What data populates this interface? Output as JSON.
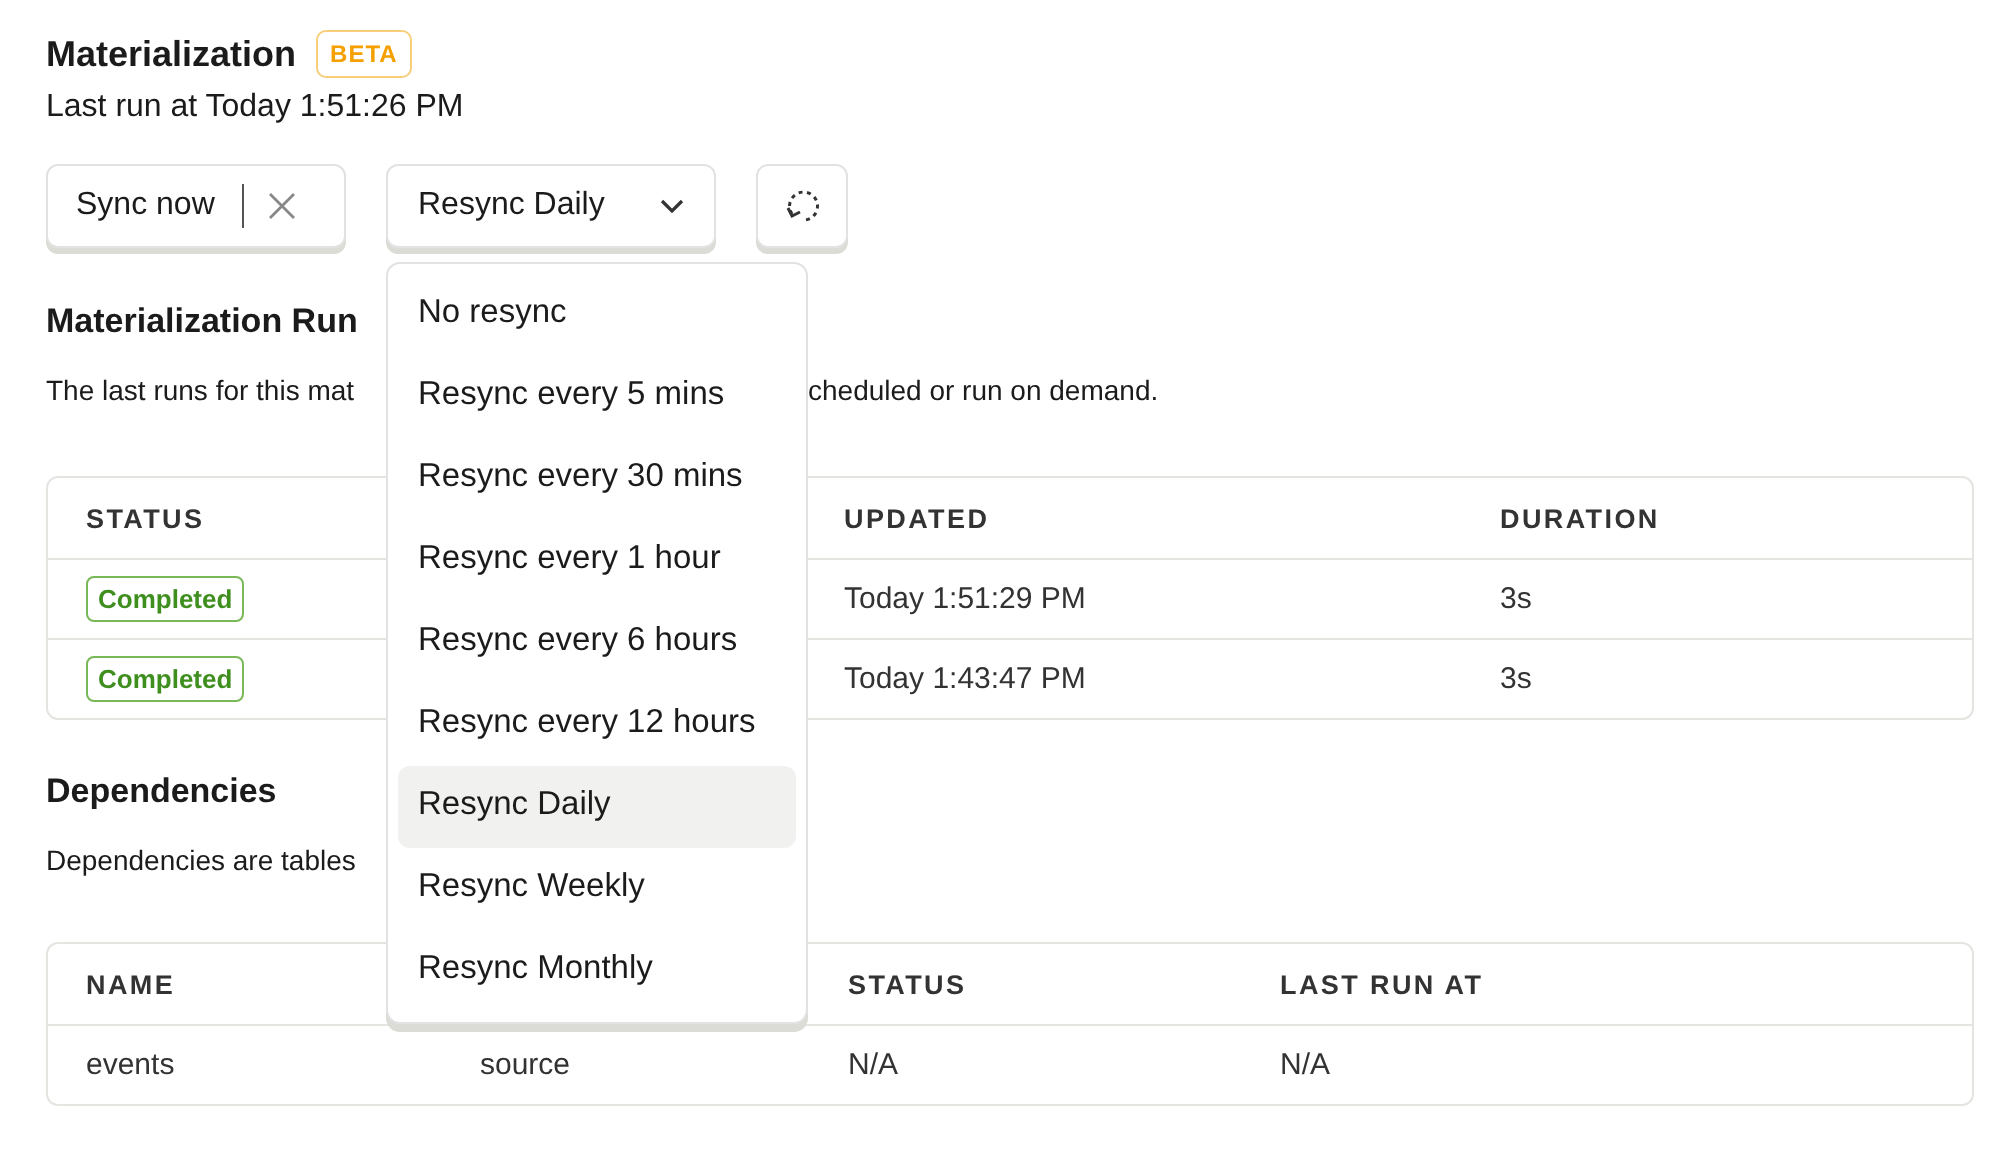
{
  "header": {
    "title": "Materialization",
    "badge": "BETA",
    "last_run": "Last run at Today 1:51:26 PM"
  },
  "toolbar": {
    "sync_button": "Sync now",
    "resync_select": "Resync Daily",
    "menu_open": true
  },
  "resync_menu": [
    {
      "label": "No resync",
      "selected": false
    },
    {
      "label": "Resync every 5 mins",
      "selected": false
    },
    {
      "label": "Resync every 30 mins",
      "selected": false
    },
    {
      "label": "Resync every 1 hour",
      "selected": false
    },
    {
      "label": "Resync every 6 hours",
      "selected": false
    },
    {
      "label": "Resync every 12 hours",
      "selected": false
    },
    {
      "label": "Resync Daily",
      "selected": true
    },
    {
      "label": "Resync Weekly",
      "selected": false
    },
    {
      "label": "Resync Monthly",
      "selected": false
    }
  ],
  "runs": {
    "title": "Materialization Run",
    "description_left": "The last runs for this mat",
    "description_right": "cheduled or run on demand.",
    "columns": [
      {
        "label": "STATUS"
      },
      {},
      {
        "label": "UPDATED"
      },
      {
        "label": "DURATION"
      }
    ],
    "rows": [
      {
        "status": "Completed",
        "updated": "Today 1:51:29 PM",
        "duration": "3s"
      },
      {
        "status": "Completed",
        "updated": "Today 1:43:47 PM",
        "duration": "3s"
      }
    ]
  },
  "dependencies": {
    "title": "Dependencies",
    "description": "Dependencies are tables",
    "columns": [
      {
        "label": "NAME"
      },
      {},
      {
        "label": "STATUS"
      },
      {
        "label": "LAST RUN AT"
      }
    ],
    "rows": [
      {
        "name": "events",
        "type": "source",
        "status": "N/A",
        "last_run_at": "N/A"
      }
    ]
  }
}
